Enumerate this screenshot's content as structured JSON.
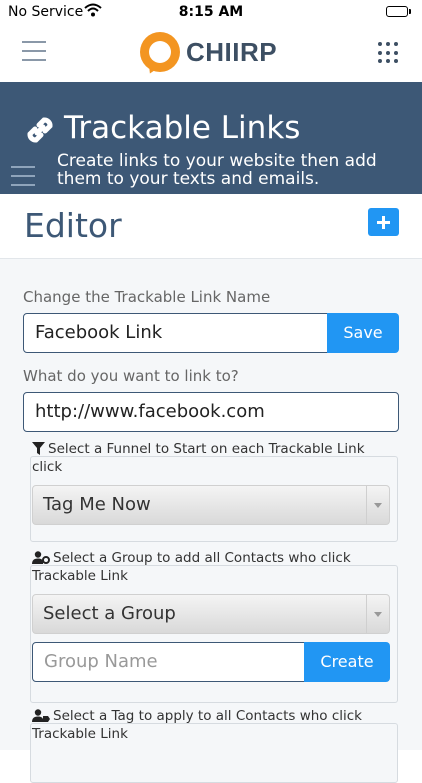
{
  "status_bar": {
    "carrier": "No Service",
    "time": "8:15 AM"
  },
  "app": {
    "name": "CHIIRP"
  },
  "banner": {
    "title": "Trackable Links",
    "subtitle": "Create links to your website then add them to your texts and emails."
  },
  "editor": {
    "heading": "Editor",
    "name_label": "Change the Trackable Link Name",
    "name_value": "Facebook Link",
    "save_label": "Save",
    "url_label": "What do you want to link to?",
    "url_value": "http://www.facebook.com",
    "funnel": {
      "title": "Select a Funnel to Start on each Trackable Link click",
      "selected": "Tag Me Now"
    },
    "group": {
      "title": "Select a Group to add all Contacts who click Trackable Link",
      "selected": "Select a Group",
      "name_placeholder": "Group Name",
      "create_label": "Create"
    },
    "tag": {
      "title": "Select a Tag to apply to all Contacts who click Trackable Link"
    }
  },
  "colors": {
    "brand_orange": "#f39521",
    "banner_blue": "#3d5876",
    "accent_blue": "#2196f3"
  }
}
